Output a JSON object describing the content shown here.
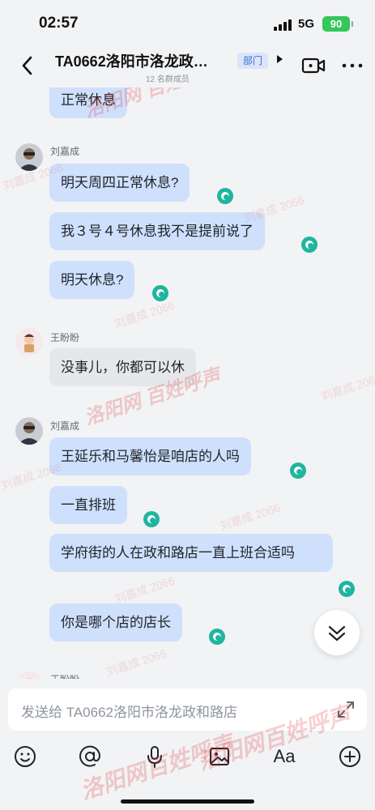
{
  "status_bar": {
    "time": "02:57",
    "network": "5G",
    "battery": "90"
  },
  "nav": {
    "title": "TA0662洛阳市洛龙政…",
    "dept_badge": "部门",
    "member_count": "12 名群成员"
  },
  "chat": {
    "partial_message": "正常休息",
    "groups": [
      {
        "sender": "刘嘉成",
        "messages": [
          "明天周四正常休息?",
          "我３号４号休息我不是提前说了",
          "明天休息?"
        ]
      },
      {
        "sender": "王盼盼",
        "messages": [
          "没事儿，你都可以休"
        ]
      },
      {
        "sender": "刘嘉成",
        "messages": [
          "王延乐和马馨怡是咱店的人吗",
          "一直排班",
          "学府街的人在政和路店一直上班合适吗",
          "你是哪个店的店长"
        ]
      }
    ],
    "partial_sender": "王盼盼"
  },
  "composer": {
    "placeholder": "发送给 TA0662洛阳市洛龙政和路店",
    "font_tool_label": "Aa"
  },
  "watermark": {
    "user": "刘嘉成 2066",
    "site": "洛阳网",
    "column": "百姓呼声"
  },
  "colors": {
    "own_bubble": "#cfe0fc",
    "other_bubble": "#e6e7ea",
    "read_receipt": "#1fb59f",
    "accent": "#3b6ad6"
  },
  "icons": [
    "back-icon",
    "video-call-icon",
    "more-icon",
    "read-receipt-icon",
    "scroll-down-icon",
    "emoji-icon",
    "mention-icon",
    "voice-icon",
    "image-icon",
    "plus-icon",
    "expand-icon"
  ]
}
